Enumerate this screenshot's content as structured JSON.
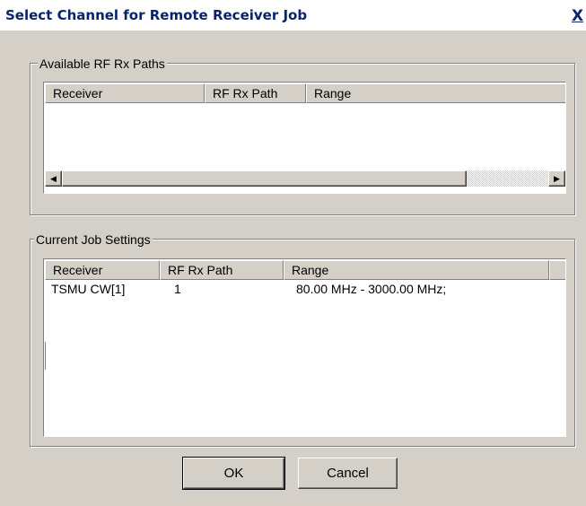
{
  "window": {
    "title": "Select Channel for Remote Receiver Job",
    "close_glyph": "X"
  },
  "available": {
    "label": "Available RF Rx Paths",
    "columns": [
      "Receiver",
      "RF Rx Path",
      "Range"
    ],
    "rows": [],
    "scroll_left_glyph": "◀",
    "scroll_right_glyph": "▶"
  },
  "current": {
    "label": "Current Job Settings",
    "columns": [
      "Receiver",
      "RF Rx Path",
      "Range",
      ""
    ],
    "rows": [
      {
        "receiver": "TSMU CW[1]",
        "path": "1",
        "range": "80.00 MHz - 3000.00 MHz;"
      }
    ]
  },
  "buttons": {
    "ok": "OK",
    "cancel": "Cancel"
  }
}
